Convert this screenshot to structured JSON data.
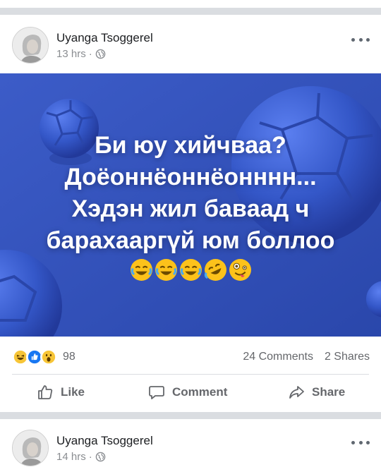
{
  "posts": [
    {
      "author": "Uyanga Tsoggerel",
      "time": "13 hrs",
      "dot": "·",
      "caption_lines": [
        "Би юу хийчваа?",
        "Доёоннёоннёонннн...",
        "Хэдэн жил бавaад ч",
        "барахааргүй юм боллоо"
      ],
      "emojis": [
        "joy-emoji",
        "joy-emoji",
        "joy-emoji",
        "rofl-emoji",
        "zany-emoji"
      ],
      "reaction_icons": [
        "haha-icon",
        "like-icon",
        "wow-icon"
      ],
      "reaction_count": "98",
      "comments": "24 Comments",
      "shares": "2 Shares",
      "actions": {
        "like": "Like",
        "comment": "Comment",
        "share": "Share"
      },
      "colors": {
        "image_bg": "#2f4fb6",
        "ball": "#3a5cd0"
      }
    },
    {
      "author": "Uyanga Tsoggerel",
      "time": "14 hrs",
      "dot": "·"
    }
  ],
  "colors": {
    "separator": "#dadde1",
    "secondary_text": "#65676b",
    "like_blue": "#1877f2"
  }
}
